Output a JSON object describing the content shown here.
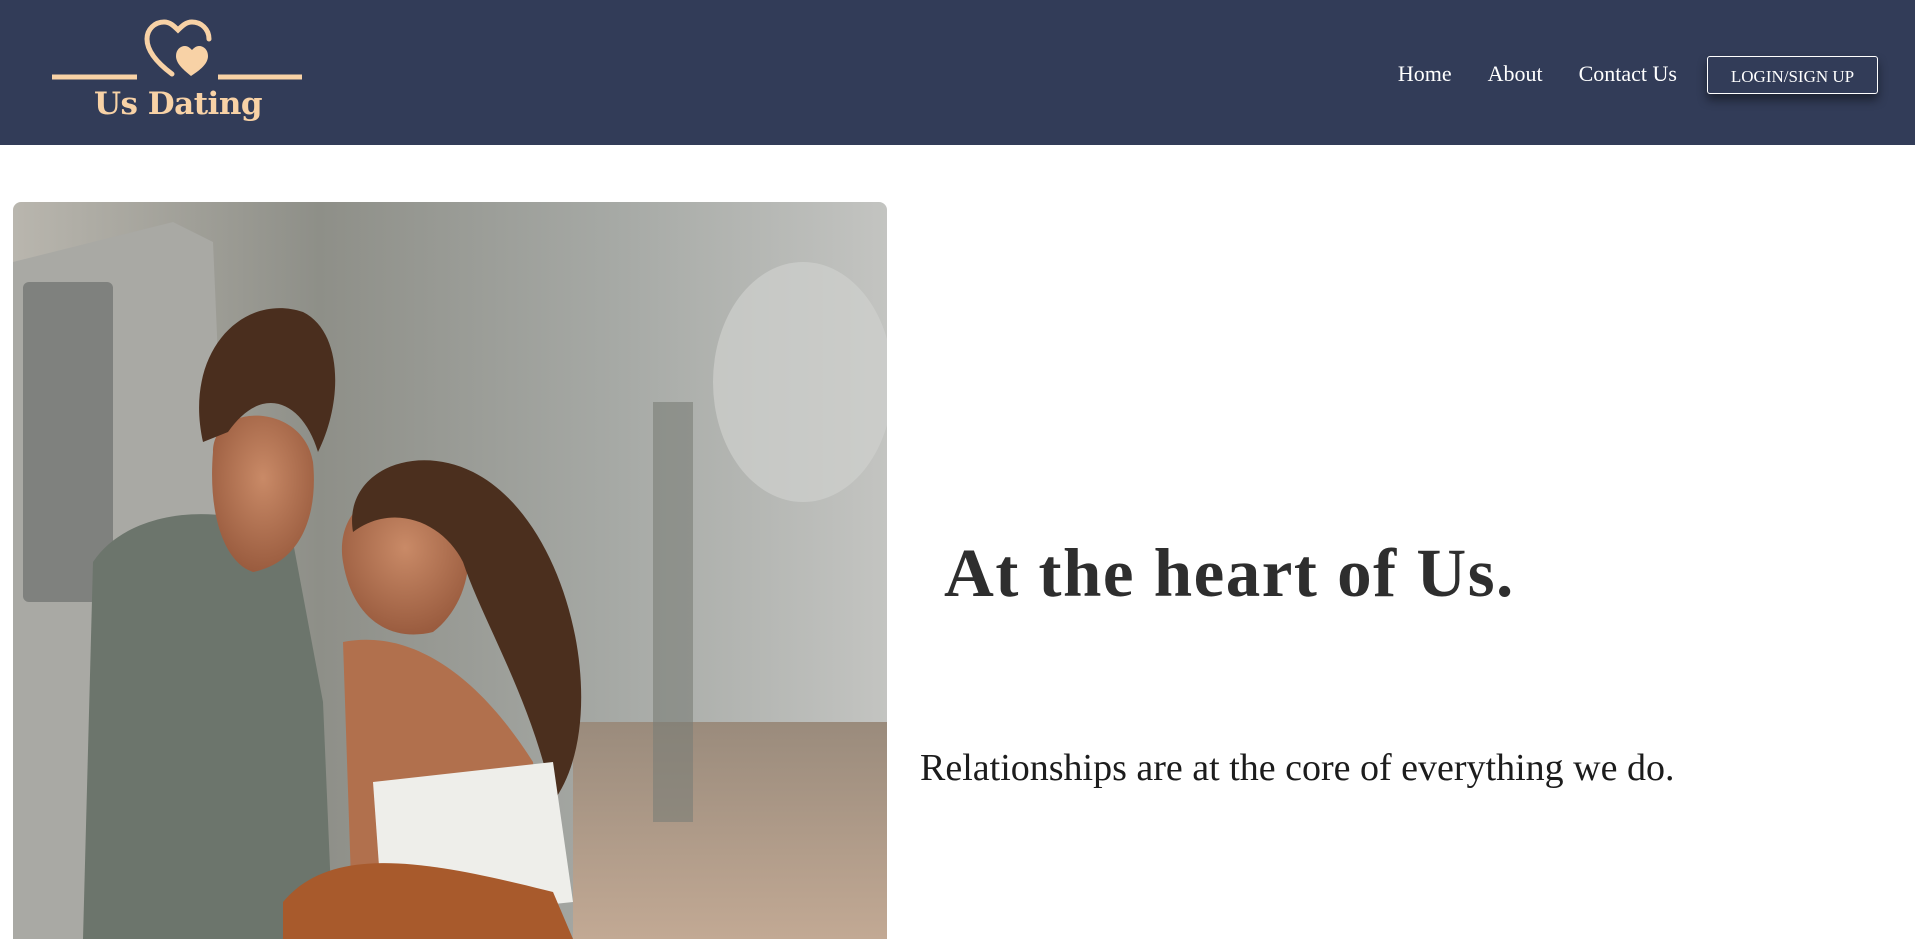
{
  "brand": {
    "name": "Us Dating",
    "logo_icon": "double-heart-icon",
    "color": "#f8d2a6"
  },
  "nav": {
    "background": "#323c58",
    "links": [
      "Home",
      "About",
      "Contact Us"
    ],
    "login_label": "LOGIN/SIGN UP"
  },
  "hero": {
    "image": "couple-photo",
    "heading": "At the heart of Us.",
    "subtext": "Relationships are at the core of everything we do."
  }
}
